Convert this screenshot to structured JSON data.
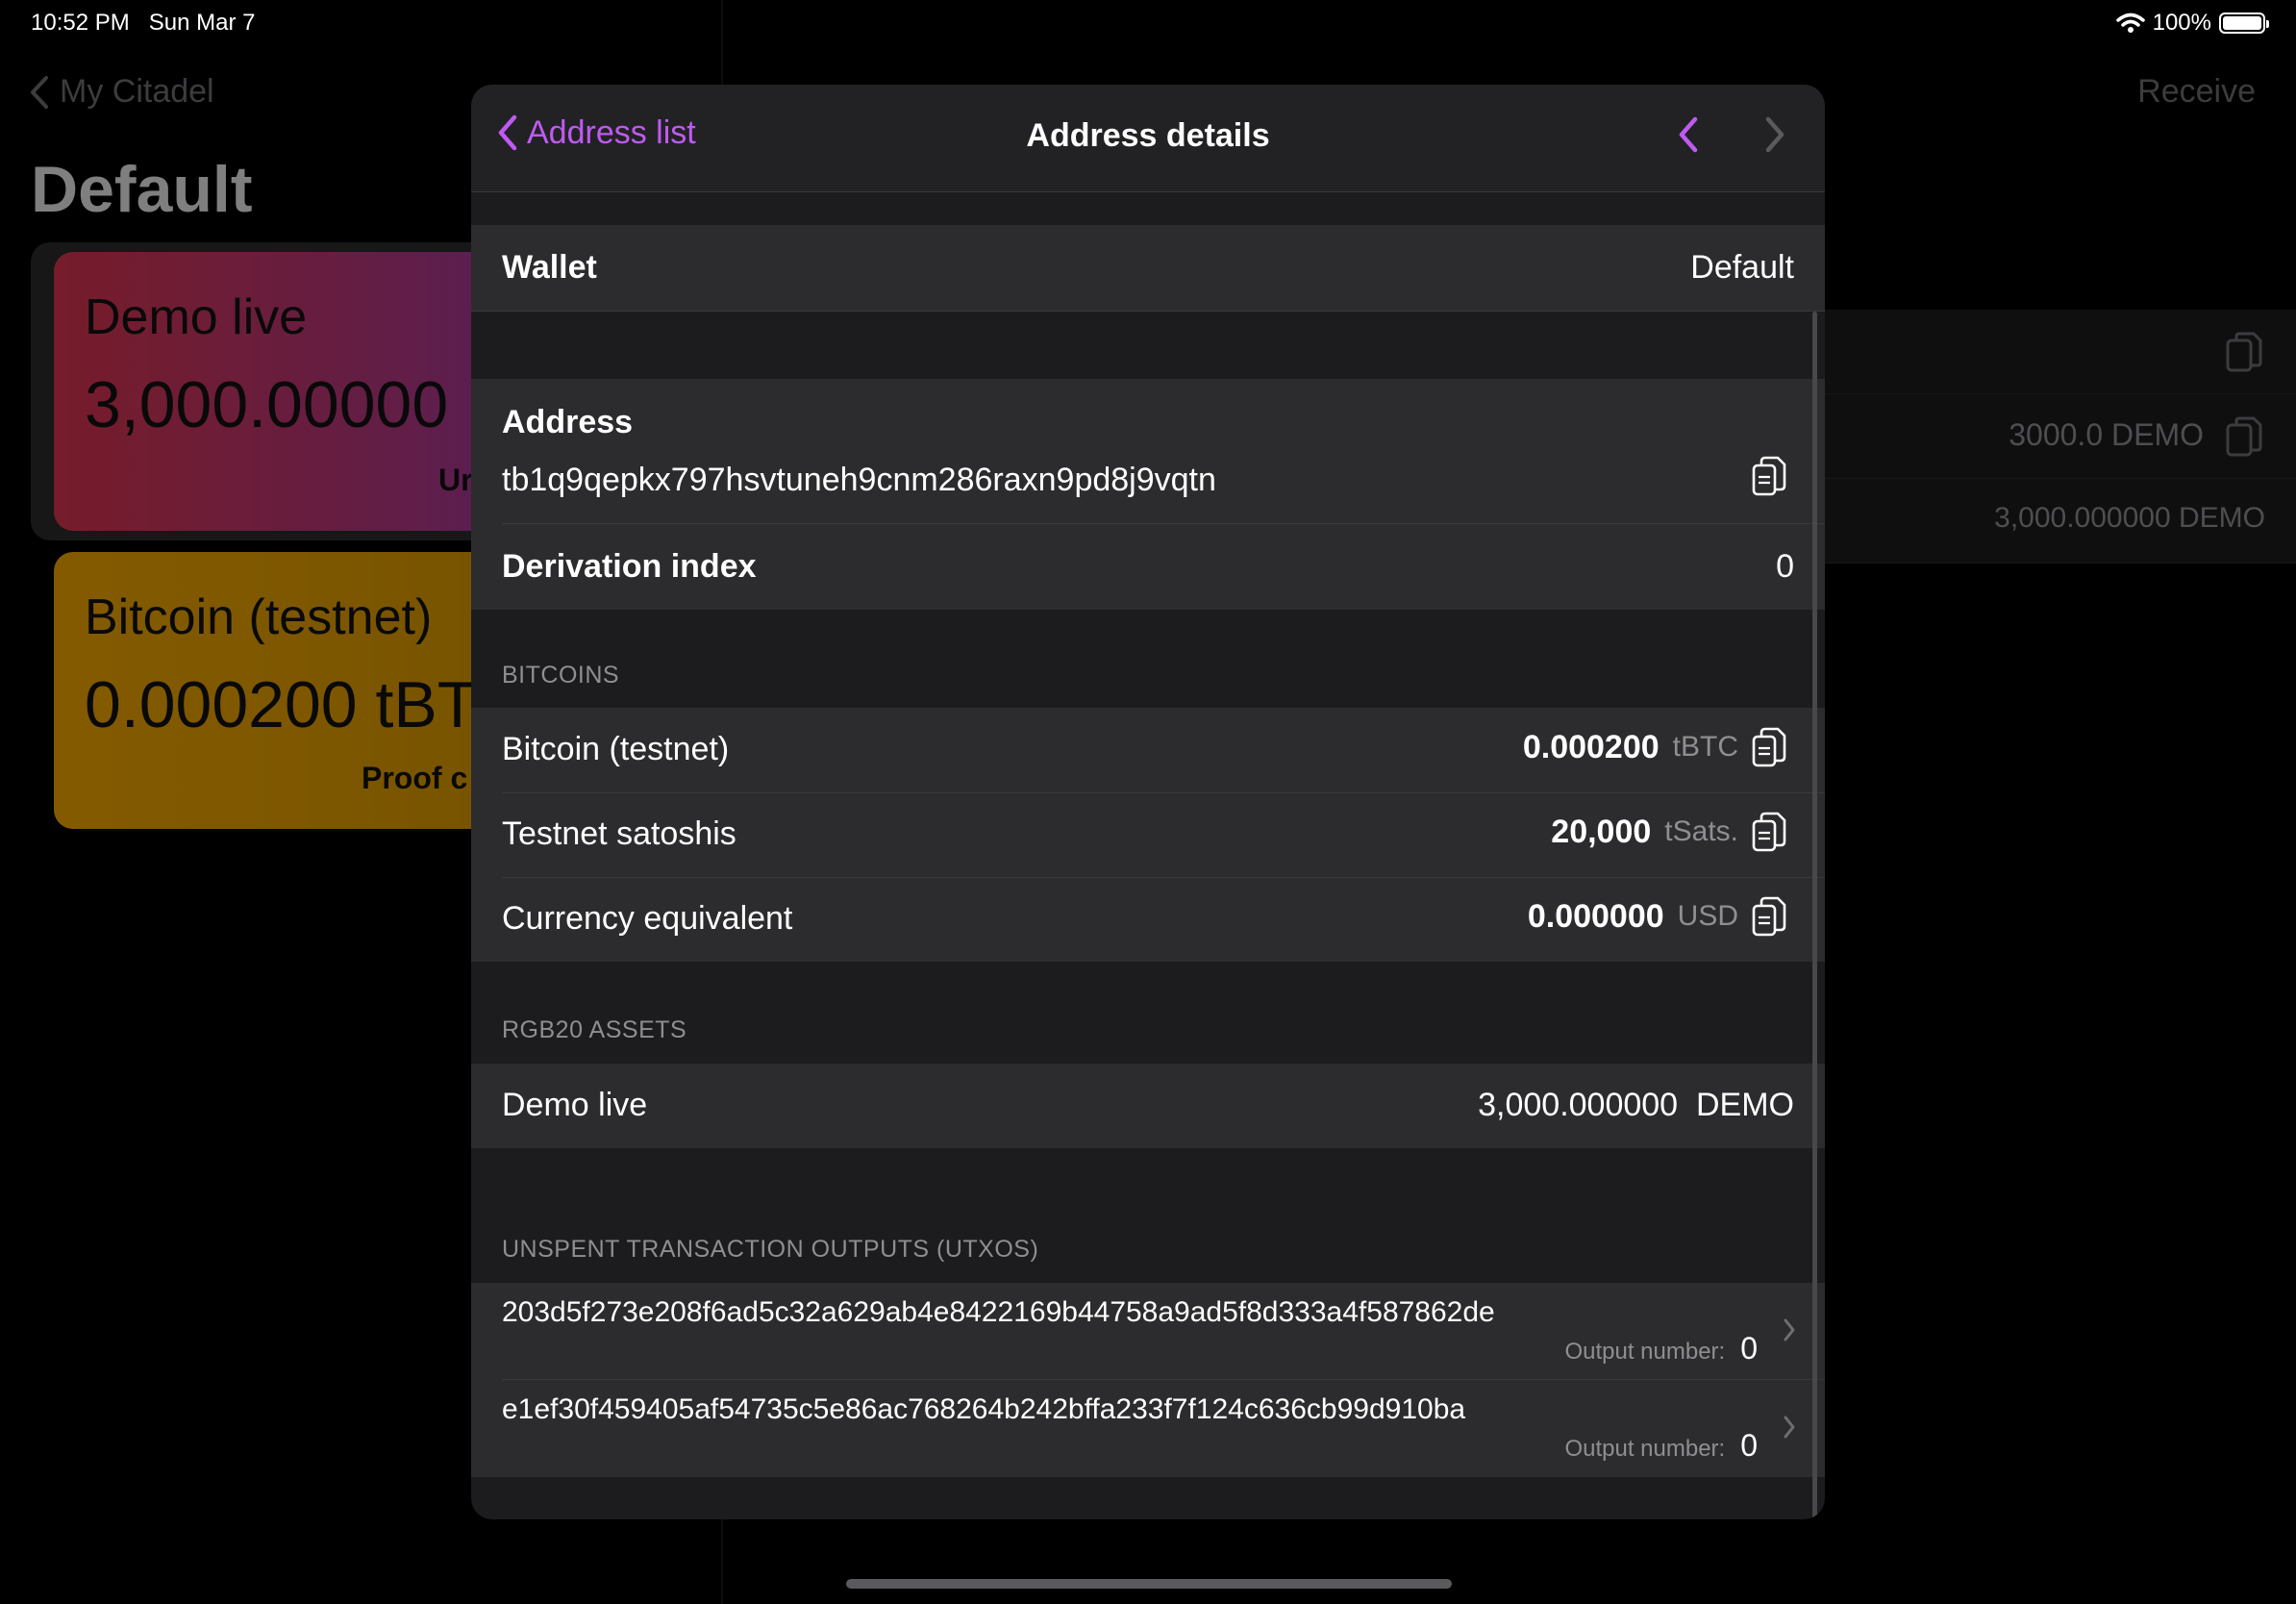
{
  "status": {
    "time": "10:52 PM",
    "date": "Sun Mar 7",
    "battery": "100%"
  },
  "background": {
    "back_label": "My Citadel",
    "title": "Default",
    "receive_label": "Receive",
    "cards": [
      {
        "name": "Demo live",
        "amount": "3,000.00000",
        "sub": "Ur"
      },
      {
        "name": "Bitcoin (testnet)",
        "amount": "0.000200 tBT",
        "sub": "Proof c"
      }
    ],
    "rows": [
      {
        "text": ""
      },
      {
        "text": "3000.0 DEMO"
      },
      {
        "text": "3,000.000000 DEMO"
      }
    ]
  },
  "modal": {
    "nav": {
      "back_label": "Address list",
      "title": "Address details"
    },
    "wallet": {
      "label": "Wallet",
      "value": "Default"
    },
    "address": {
      "label": "Address",
      "value": "tb1q9qepkx797hsvtuneh9cnm286raxn9pd8j9vqtn"
    },
    "derivation": {
      "label": "Derivation index",
      "value": "0"
    },
    "bitcoins": {
      "header": "BITCOINS",
      "rows": [
        {
          "label": "Bitcoin (testnet)",
          "amount": "0.000200",
          "unit": "tBTC"
        },
        {
          "label": "Testnet satoshis",
          "amount": "20,000",
          "unit": "tSats."
        },
        {
          "label": "Currency equivalent",
          "amount": "0.000000",
          "unit": "USD"
        }
      ]
    },
    "rgb20": {
      "header": "RGB20 ASSETS",
      "rows": [
        {
          "label": "Demo live",
          "value": "3,000.000000  DEMO"
        }
      ]
    },
    "utxos": {
      "header": "UNSPENT TRANSACTION OUTPUTS (UTXOS)",
      "output_label": "Output number:",
      "rows": [
        {
          "hash": "203d5f273e208f6ad5c32a629ab4e8422169b44758a9ad5f8d333a4f587862de",
          "output": "0"
        },
        {
          "hash": "e1ef30f459405af54735c5e86ac768264b242bffa233f7f124c636cb99d910ba",
          "output": "0"
        }
      ]
    }
  },
  "colors": {
    "accent": "#bf5af2",
    "cell_bg": "#2c2c2e",
    "modal_bg": "#1c1c1e",
    "secondary_text": "#8e8e93"
  },
  "icons": [
    "wifi-icon",
    "battery-icon",
    "chevron-left-icon",
    "chevron-right-icon",
    "copy-icon"
  ]
}
